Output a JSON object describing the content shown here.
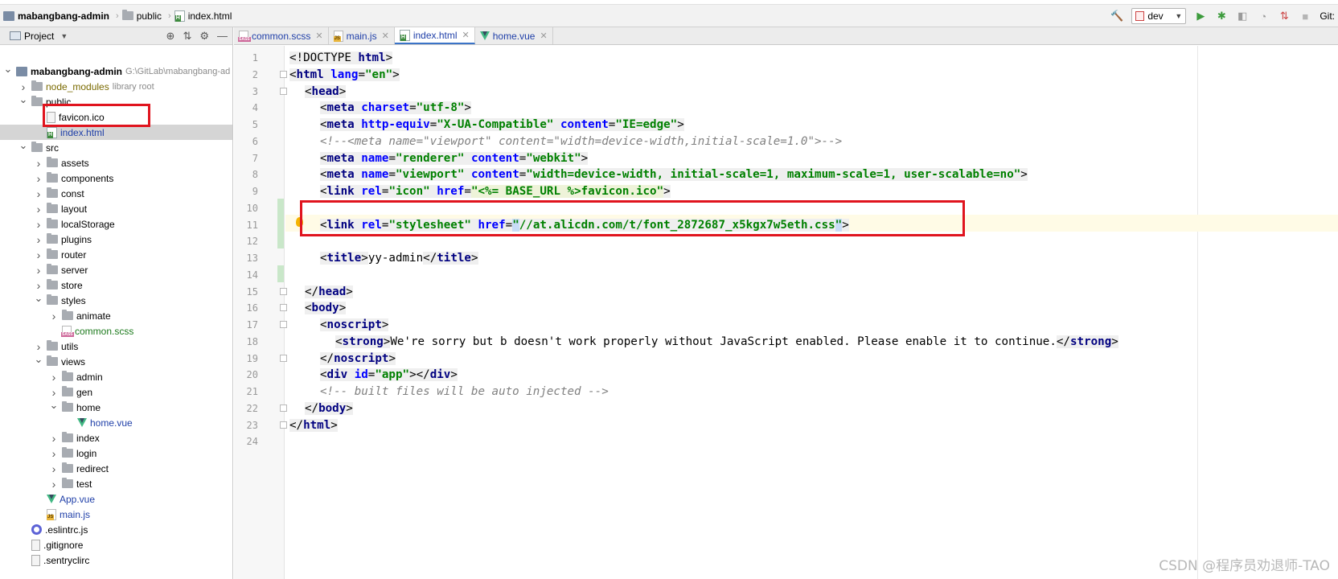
{
  "breadcrumb": {
    "project": "mabangbang-admin",
    "folder": "public",
    "file": "index.html"
  },
  "toolbar": {
    "run_config": "dev",
    "git_label": "Git:"
  },
  "project_panel": {
    "title": "Project",
    "tree": [
      {
        "label": "mabangbang-admin",
        "extra": "G:\\GitLab\\mabangbang-ad",
        "type": "project"
      },
      {
        "label": "node_modules",
        "extra": "library root",
        "type": "folder"
      },
      {
        "label": "public",
        "type": "folder"
      },
      {
        "label": "favicon.ico",
        "type": "file"
      },
      {
        "label": "index.html",
        "type": "html"
      },
      {
        "label": "src",
        "type": "folder"
      },
      {
        "label": "assets",
        "type": "folder"
      },
      {
        "label": "components",
        "type": "folder"
      },
      {
        "label": "const",
        "type": "folder"
      },
      {
        "label": "layout",
        "type": "folder"
      },
      {
        "label": "localStorage",
        "type": "folder"
      },
      {
        "label": "plugins",
        "type": "folder"
      },
      {
        "label": "router",
        "type": "folder"
      },
      {
        "label": "server",
        "type": "folder"
      },
      {
        "label": "store",
        "type": "folder"
      },
      {
        "label": "styles",
        "type": "folder"
      },
      {
        "label": "animate",
        "type": "folder"
      },
      {
        "label": "common.scss",
        "type": "sass"
      },
      {
        "label": "utils",
        "type": "folder"
      },
      {
        "label": "views",
        "type": "folder"
      },
      {
        "label": "admin",
        "type": "folder"
      },
      {
        "label": "gen",
        "type": "folder"
      },
      {
        "label": "home",
        "type": "folder"
      },
      {
        "label": "home.vue",
        "type": "vue"
      },
      {
        "label": "index",
        "type": "folder"
      },
      {
        "label": "login",
        "type": "folder"
      },
      {
        "label": "redirect",
        "type": "folder"
      },
      {
        "label": "test",
        "type": "folder"
      },
      {
        "label": "App.vue",
        "type": "vue"
      },
      {
        "label": "main.js",
        "type": "js"
      },
      {
        "label": ".eslintrc.js",
        "type": "cfg"
      },
      {
        "label": ".gitignore",
        "type": "file"
      },
      {
        "label": ".sentryclirc",
        "type": "file"
      }
    ]
  },
  "tabs": [
    {
      "label": "common.scss",
      "icon": "sass-icon"
    },
    {
      "label": "main.js",
      "icon": "js-icon"
    },
    {
      "label": "index.html",
      "icon": "html-icon",
      "active": true
    },
    {
      "label": "home.vue",
      "icon": "vue-icon"
    }
  ],
  "line_numbers": [
    "1",
    "2",
    "3",
    "4",
    "5",
    "6",
    "7",
    "8",
    "9",
    "10",
    "11",
    "12",
    "13",
    "14",
    "15",
    "16",
    "17",
    "18",
    "19",
    "20",
    "21",
    "22",
    "23",
    "24"
  ],
  "code": {
    "l1": {
      "open": "<!DOCTYPE ",
      "tag": "html",
      "close": ">"
    },
    "l2": {
      "lt": "<",
      "tag": "html",
      "attr": " lang",
      "eq": "=",
      "val": "\"en\"",
      "gt": ">"
    },
    "l3": {
      "lt": "<",
      "tag": "head",
      "gt": ">"
    },
    "l4": {
      "lt": "<",
      "tag": "meta",
      "attr": " charset",
      "eq": "=",
      "val": "\"utf-8\"",
      "gt": ">"
    },
    "l5": {
      "lt": "<",
      "tag": "meta",
      "a1": " http-equiv",
      "v1": "\"X-UA-Compatible\"",
      "a2": " content",
      "v2": "\"IE=edge\"",
      "gt": ">"
    },
    "l6": {
      "comment": "<!--<meta name=\"viewport\" content=\"width=device-width,initial-scale=1.0\">-->"
    },
    "l7": {
      "lt": "<",
      "tag": "meta",
      "a1": " name",
      "v1": "\"renderer\"",
      "a2": " content",
      "v2": "\"webkit\"",
      "gt": ">"
    },
    "l8": {
      "lt": "<",
      "tag": "meta",
      "a1": " name",
      "v1": "\"viewport\"",
      "a2": " content",
      "v2": "\"width=device-width, initial-scale=1, maximum-scale=1, user-scalable=no\"",
      "gt": ">"
    },
    "l9": {
      "lt": "<",
      "tag": "link",
      "a1": " rel",
      "v1": "\"icon\"",
      "a2": " href",
      "v2": "\"<%= BASE_URL %>favicon.ico\"",
      "gt": ">"
    },
    "l11": {
      "lt": "<",
      "tag": "link",
      "a1": " rel",
      "v1": "\"stylesheet\"",
      "a2": " href",
      "q1": "\"",
      "v2": "//at.alicdn.com/t/font_2872687_x5kgx7w5eth.css",
      "q2": "\"",
      "gt": ">"
    },
    "l13": {
      "lt": "<",
      "tag": "title",
      "gt": ">",
      "text": "yy-admin",
      "lt2": "</",
      "tag2": "title",
      "gt2": ">"
    },
    "l15": {
      "lt": "</",
      "tag": "head",
      "gt": ">"
    },
    "l16": {
      "lt": "<",
      "tag": "body",
      "gt": ">"
    },
    "l17": {
      "lt": "<",
      "tag": "noscript",
      "gt": ">"
    },
    "l18": {
      "lt": "<",
      "tag": "strong",
      "gt": ">",
      "text": "We're sorry but b doesn't work properly without JavaScript enabled. Please enable it to continue.",
      "lt2": "</",
      "tag2": "strong",
      "gt2": ">"
    },
    "l19": {
      "lt": "</",
      "tag": "noscript",
      "gt": ">"
    },
    "l20": {
      "lt": "<",
      "tag": "div",
      "attr": " id",
      "eq": "=",
      "val": "\"app\"",
      "gt": ">",
      "lt2": "</",
      "tag2": "div",
      "gt2": ">"
    },
    "l21": {
      "comment": "<!-- built files will be auto injected -->"
    },
    "l22": {
      "lt": "</",
      "tag": "body",
      "gt": ">"
    },
    "l23": {
      "lt": "</",
      "tag": "html",
      "gt": ">"
    }
  },
  "watermark": "CSDN @程序员劝退师-TAO",
  "colors": {
    "highlight_box": "#e0141e",
    "tag": "#000080",
    "attr": "#0000ff",
    "value": "#008000",
    "comment": "#808080"
  }
}
